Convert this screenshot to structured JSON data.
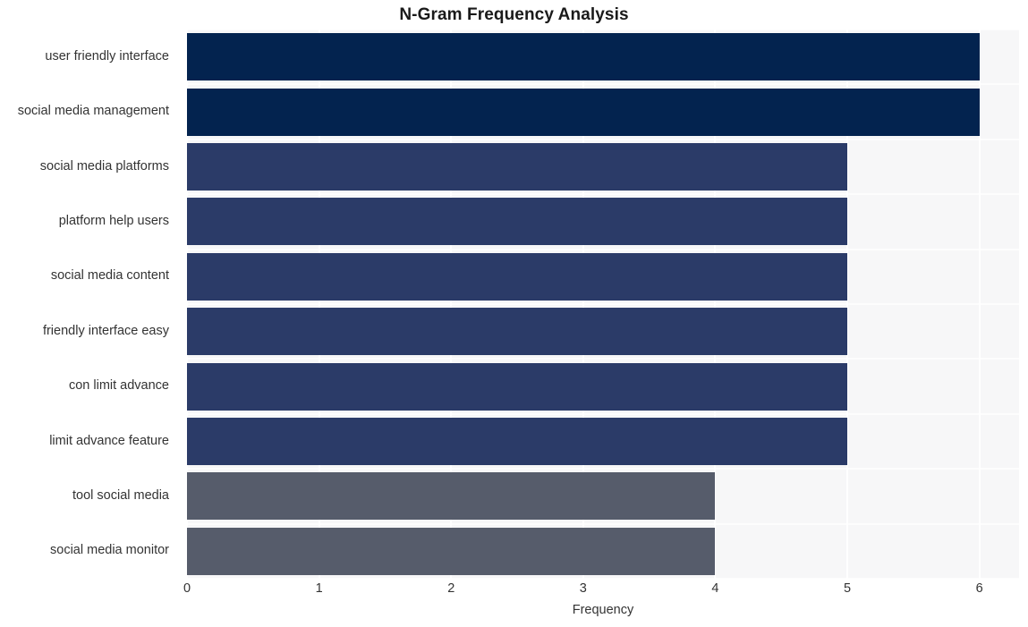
{
  "chart_data": {
    "type": "bar",
    "orientation": "horizontal",
    "title": "N-Gram Frequency Analysis",
    "xlabel": "Frequency",
    "ylabel": "",
    "xlim": [
      0,
      6.3
    ],
    "xticks": [
      0,
      1,
      2,
      3,
      4,
      5,
      6
    ],
    "xtick_labels": [
      "0",
      "1",
      "2",
      "3",
      "4",
      "5",
      "6"
    ],
    "grid": true,
    "legend": false,
    "categories": [
      "user friendly interface",
      "social media management",
      "social media platforms",
      "platform help users",
      "social media content",
      "friendly interface easy",
      "con limit advance",
      "limit advance feature",
      "tool social media",
      "social media monitor"
    ],
    "values": [
      6,
      6,
      5,
      5,
      5,
      5,
      5,
      5,
      4,
      4
    ],
    "bar_colors": [
      "#03234f",
      "#03234f",
      "#2b3b68",
      "#2b3b68",
      "#2b3b68",
      "#2b3b68",
      "#2b3b68",
      "#2b3b68",
      "#565c6b",
      "#565c6b"
    ],
    "plot_background": "#f7f7f8",
    "figure_background": "#ffffff",
    "gridline_color": "#ffffff",
    "text_color": "#333333",
    "title_color": "#1a1a1a"
  }
}
